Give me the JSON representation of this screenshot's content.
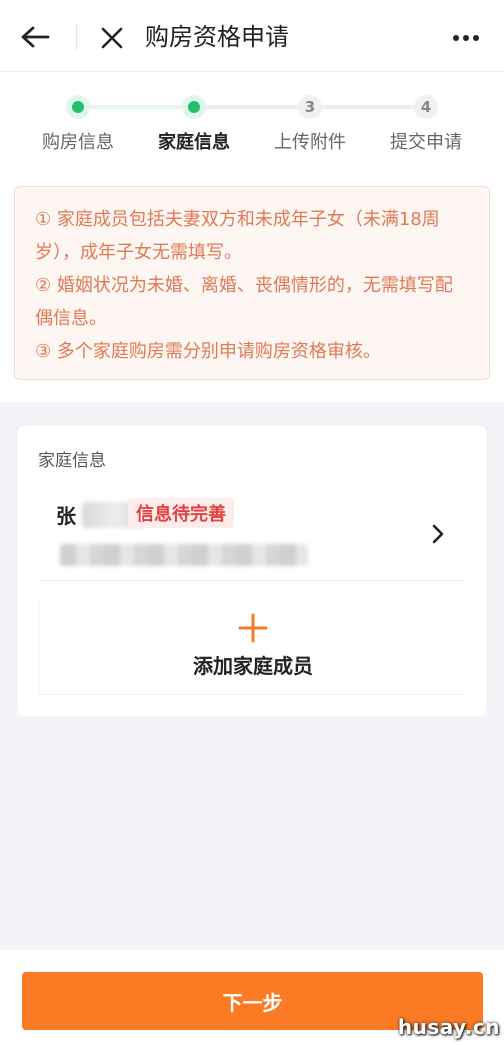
{
  "header": {
    "title": "购房资格申请",
    "back_icon": "arrow-left-icon",
    "close_icon": "close-icon",
    "more_icon": "more-dots-icon"
  },
  "steps": {
    "items": [
      {
        "label": "购房信息",
        "marker": "",
        "state": "done"
      },
      {
        "label": "家庭信息",
        "marker": "",
        "state": "current"
      },
      {
        "label": "上传附件",
        "marker": "3",
        "state": "pending"
      },
      {
        "label": "提交申请",
        "marker": "4",
        "state": "pending"
      }
    ],
    "active_color": "#23c06b"
  },
  "notice": {
    "lines": [
      "① 家庭成员包括夫妻双方和未成年子女（未满18周岁），成年子女无需填写。",
      "② 婚姻状况为未婚、离婚、丧偶情形的，无需填写配偶信息。",
      "③ 多个家庭购房需分别申请购房资格审核。"
    ],
    "text_color": "#e07a56"
  },
  "family": {
    "title": "家庭信息",
    "member": {
      "name_visible": "张",
      "status_badge": "信息待完善",
      "badge_color": "#e34242"
    },
    "add_label": "添加家庭成员",
    "add_icon": "plus-icon",
    "accent": "#fb7a23"
  },
  "footer": {
    "next_label": "下一步"
  },
  "watermark": "husay.cn"
}
